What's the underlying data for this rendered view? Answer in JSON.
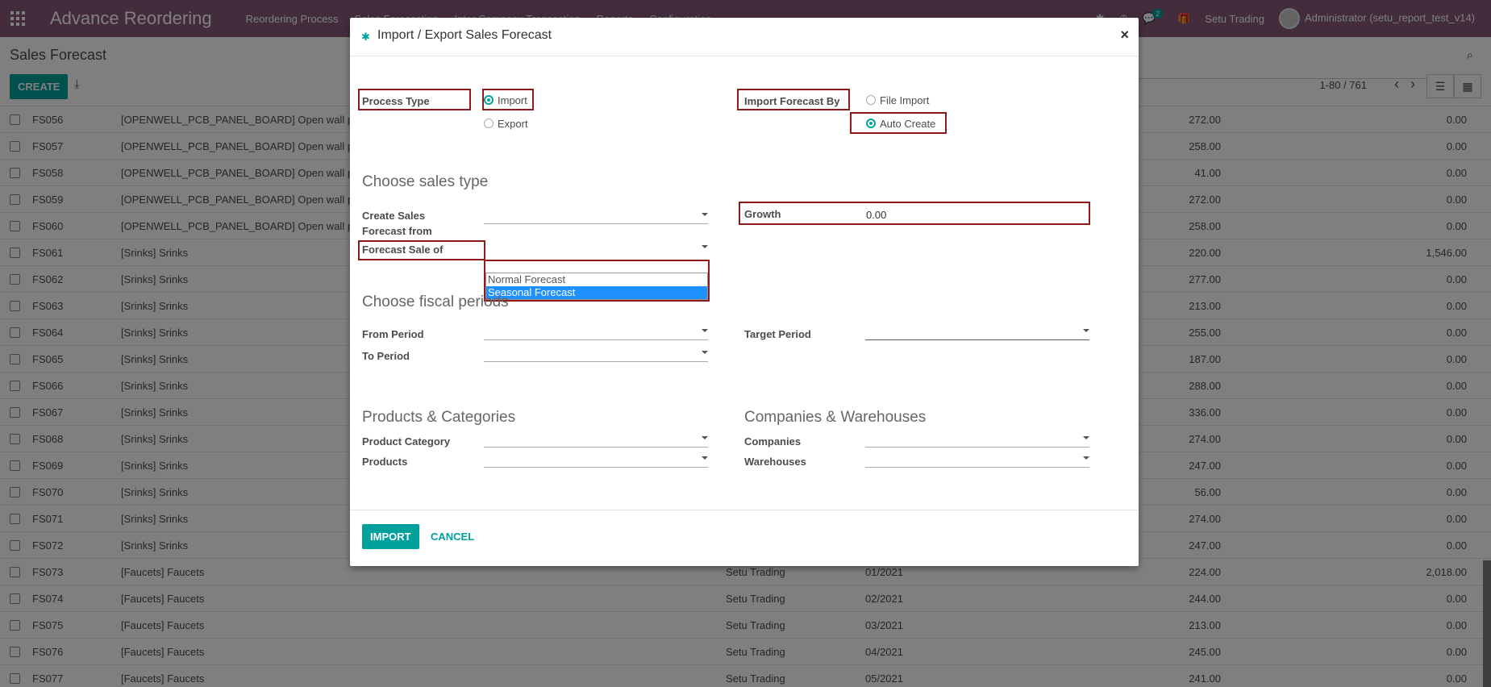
{
  "navbar": {
    "app_title": "Advance Reordering",
    "menu": [
      "Reordering Process",
      "Sales Forecasting",
      "Inter Company Transaction",
      "Reports",
      "Configuration"
    ],
    "company": "Setu Trading",
    "user": "Administrator (setu_report_test_v14)",
    "messages_badge": "2"
  },
  "control": {
    "breadcrumb": "Sales Forecast",
    "create_label": "CREATE",
    "pager": "1-80 / 761"
  },
  "rows": [
    {
      "code": "FS056",
      "product": "[OPENWELL_PCB_PANEL_BOARD] Open wall pcb",
      "company": "",
      "period": "",
      "qty": "272.00",
      "amt": "0.00"
    },
    {
      "code": "FS057",
      "product": "[OPENWELL_PCB_PANEL_BOARD] Open wall pcb",
      "company": "",
      "period": "",
      "qty": "258.00",
      "amt": "0.00"
    },
    {
      "code": "FS058",
      "product": "[OPENWELL_PCB_PANEL_BOARD] Open wall pcb",
      "company": "",
      "period": "",
      "qty": "41.00",
      "amt": "0.00"
    },
    {
      "code": "FS059",
      "product": "[OPENWELL_PCB_PANEL_BOARD] Open wall pcb",
      "company": "",
      "period": "",
      "qty": "272.00",
      "amt": "0.00"
    },
    {
      "code": "FS060",
      "product": "[OPENWELL_PCB_PANEL_BOARD] Open wall pcb",
      "company": "",
      "period": "",
      "qty": "258.00",
      "amt": "0.00"
    },
    {
      "code": "FS061",
      "product": "[Srinks] Srinks",
      "company": "",
      "period": "",
      "qty": "220.00",
      "amt": "1,546.00"
    },
    {
      "code": "FS062",
      "product": "[Srinks] Srinks",
      "company": "",
      "period": "",
      "qty": "277.00",
      "amt": "0.00"
    },
    {
      "code": "FS063",
      "product": "[Srinks] Srinks",
      "company": "",
      "period": "",
      "qty": "213.00",
      "amt": "0.00"
    },
    {
      "code": "FS064",
      "product": "[Srinks] Srinks",
      "company": "",
      "period": "",
      "qty": "255.00",
      "amt": "0.00"
    },
    {
      "code": "FS065",
      "product": "[Srinks] Srinks",
      "company": "",
      "period": "",
      "qty": "187.00",
      "amt": "0.00"
    },
    {
      "code": "FS066",
      "product": "[Srinks] Srinks",
      "company": "",
      "period": "",
      "qty": "288.00",
      "amt": "0.00"
    },
    {
      "code": "FS067",
      "product": "[Srinks] Srinks",
      "company": "",
      "period": "",
      "qty": "336.00",
      "amt": "0.00"
    },
    {
      "code": "FS068",
      "product": "[Srinks] Srinks",
      "company": "",
      "period": "",
      "qty": "274.00",
      "amt": "0.00"
    },
    {
      "code": "FS069",
      "product": "[Srinks] Srinks",
      "company": "",
      "period": "",
      "qty": "247.00",
      "amt": "0.00"
    },
    {
      "code": "FS070",
      "product": "[Srinks] Srinks",
      "company": "",
      "period": "",
      "qty": "56.00",
      "amt": "0.00"
    },
    {
      "code": "FS071",
      "product": "[Srinks] Srinks",
      "company": "",
      "period": "",
      "qty": "274.00",
      "amt": "0.00"
    },
    {
      "code": "FS072",
      "product": "[Srinks] Srinks",
      "company": "",
      "period": "",
      "qty": "247.00",
      "amt": "0.00"
    },
    {
      "code": "FS073",
      "product": "[Faucets] Faucets",
      "company": "Setu Trading",
      "period": "01/2021",
      "qty": "224.00",
      "amt": "2,018.00"
    },
    {
      "code": "FS074",
      "product": "[Faucets] Faucets",
      "company": "Setu Trading",
      "period": "02/2021",
      "qty": "244.00",
      "amt": "0.00"
    },
    {
      "code": "FS075",
      "product": "[Faucets] Faucets",
      "company": "Setu Trading",
      "period": "03/2021",
      "qty": "213.00",
      "amt": "0.00"
    },
    {
      "code": "FS076",
      "product": "[Faucets] Faucets",
      "company": "Setu Trading",
      "period": "04/2021",
      "qty": "245.00",
      "amt": "0.00"
    },
    {
      "code": "FS077",
      "product": "[Faucets] Faucets",
      "company": "Setu Trading",
      "period": "05/2021",
      "qty": "241.00",
      "amt": "0.00"
    }
  ],
  "modal": {
    "title": "Import / Export Sales Forecast",
    "process_type_label": "Process Type",
    "import_label": "Import",
    "export_label": "Export",
    "import_by_label": "Import Forecast By",
    "file_import_label": "File Import",
    "auto_create_label": "Auto Create",
    "section_sales": "Choose sales type",
    "create_from_label": "Create Sales Forecast from",
    "growth_label": "Growth",
    "growth_value": "0.00",
    "forecast_sale_of_label": "Forecast Sale of",
    "dropdown_options": [
      "Normal Forecast",
      "Seasonal Forecast"
    ],
    "section_fiscal": "Choose fiscal periods",
    "from_period_label": "From Period",
    "to_period_label": "To Period",
    "target_period_label": "Target Period",
    "section_products": "Products & Categories",
    "section_companies": "Companies & Warehouses",
    "product_category_label": "Product Category",
    "products_label": "Products",
    "companies_label": "Companies",
    "warehouses_label": "Warehouses",
    "import_button": "IMPORT",
    "cancel_button": "CANCEL"
  }
}
